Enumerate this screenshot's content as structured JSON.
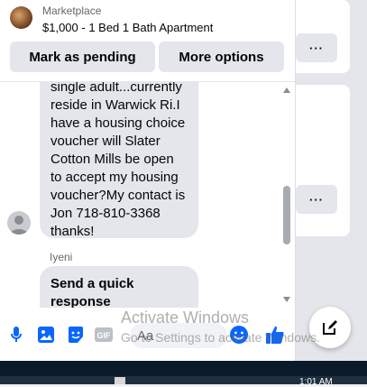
{
  "header": {
    "label": "Marketplace",
    "listing_title": "$1,000 - 1 Bed 1 Bath Apartment"
  },
  "actions": {
    "mark_pending": "Mark as pending",
    "more_options": "More options"
  },
  "messages": [
    {
      "text": "single adult...currently reside in Warwick Ri.I have a housing choice voucher will Slater Cotton Mills be open to accept my housing voucher?My contact is Jon 718-810-3368 thanks!"
    },
    {
      "sender": "Iyeni",
      "text": "Send a quick response"
    }
  ],
  "composer": {
    "placeholder": "Aa",
    "icons": [
      "microphone-icon",
      "photo-icon",
      "sticker-icon",
      "gif-icon",
      "emoji-icon",
      "thumbs-up-icon"
    ],
    "accent": "#0866ff"
  },
  "background": {
    "more_label": "···"
  },
  "watermark": {
    "title": "Activate Windows",
    "subtitle": "Go to Settings to activate Windows."
  },
  "taskbar": {
    "time": "1:01 AM"
  }
}
